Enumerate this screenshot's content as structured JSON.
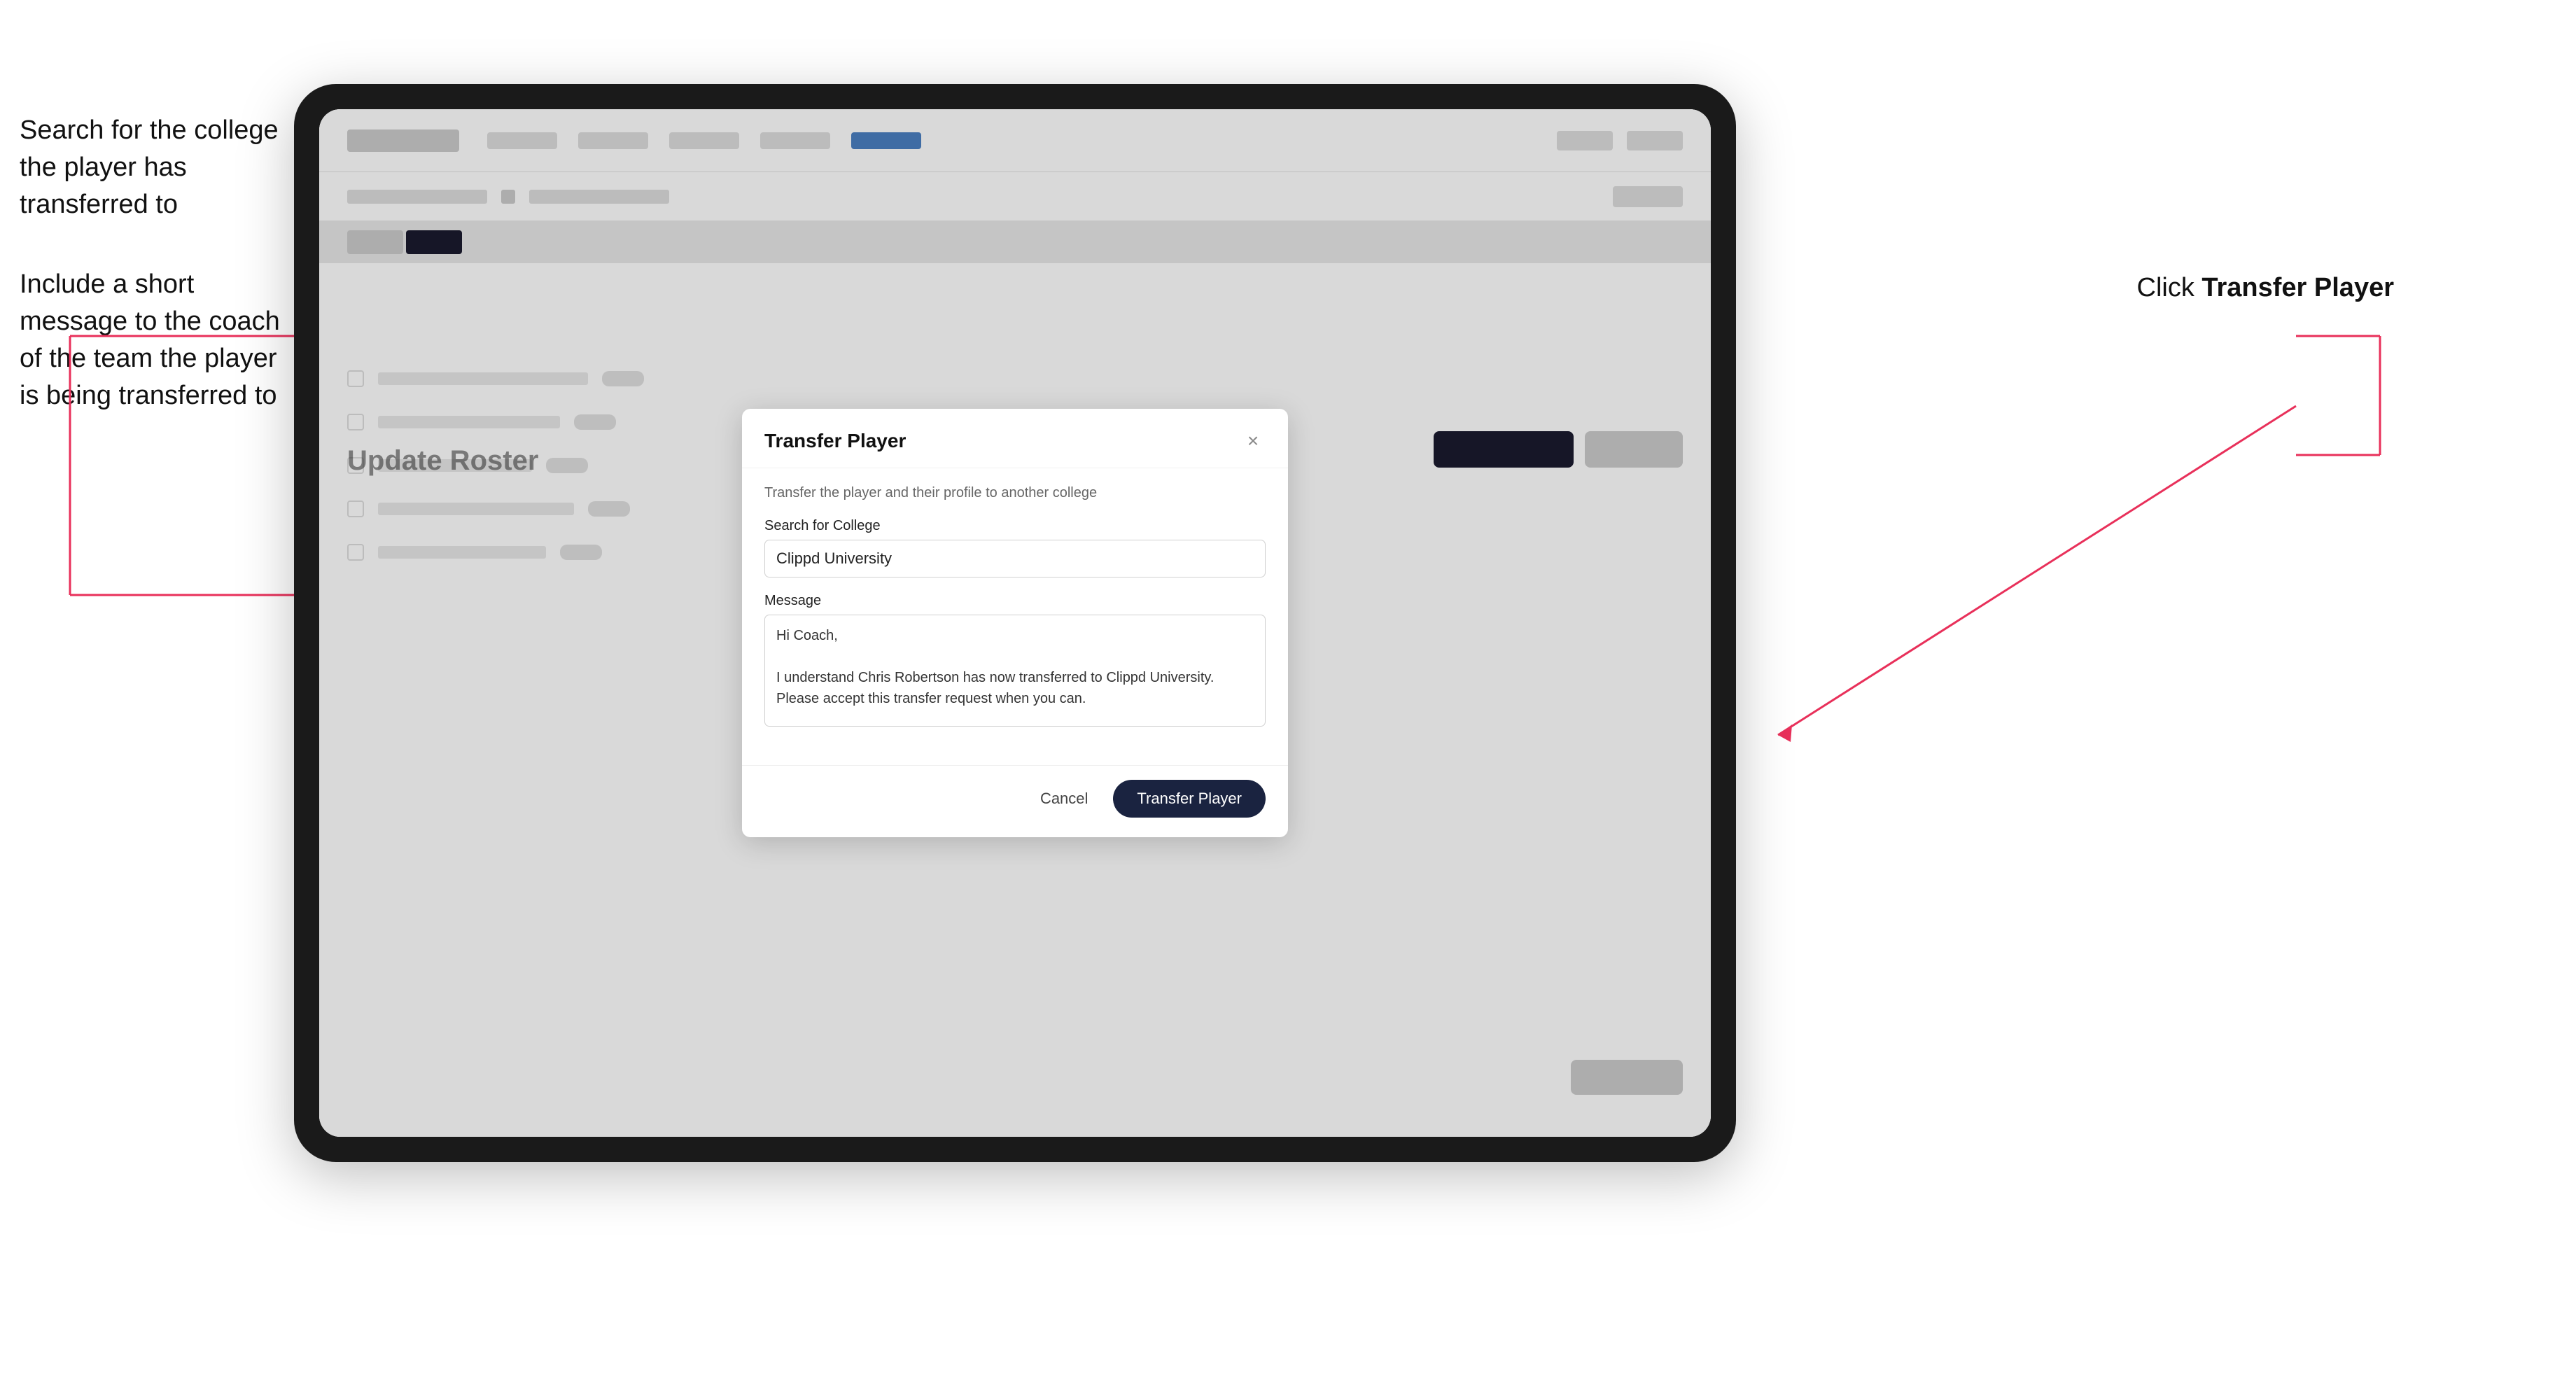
{
  "annotations": {
    "left_title1": "Search for the college the player has transferred to",
    "left_title2": "Include a short message to the coach of the team the player is being transferred to",
    "right_label_prefix": "Click ",
    "right_label_bold": "Transfer Player"
  },
  "ipad": {
    "bg_page_title": "Update Roster"
  },
  "modal": {
    "title": "Transfer Player",
    "description": "Transfer the player and their profile to another college",
    "search_label": "Search for College",
    "search_value": "Clippd University",
    "message_label": "Message",
    "message_value": "Hi Coach,\n\nI understand Chris Robertson has now transferred to Clippd University. Please accept this transfer request when you can.",
    "cancel_label": "Cancel",
    "transfer_label": "Transfer Player",
    "close_label": "×"
  }
}
